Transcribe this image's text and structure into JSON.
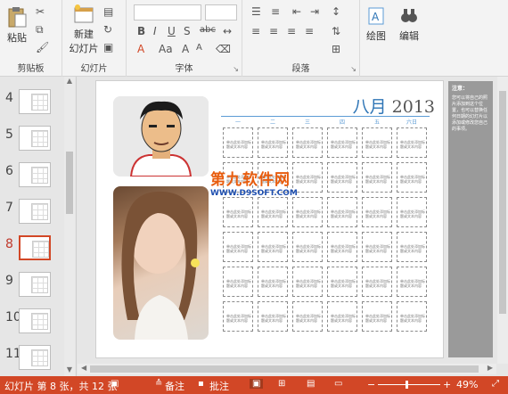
{
  "ribbon": {
    "clipboard": {
      "paste_label": "粘贴",
      "group_label": "剪贴板"
    },
    "slides": {
      "new_slide_line1": "新建",
      "new_slide_line2": "幻灯片",
      "group_label": "幻灯片"
    },
    "font": {
      "group_label": "字体"
    },
    "paragraph": {
      "group_label": "段落"
    },
    "drawing": {
      "label": "绘图"
    },
    "editing": {
      "label": "编辑"
    }
  },
  "thumbnails": [
    {
      "num": "4",
      "selected": false
    },
    {
      "num": "5",
      "selected": false
    },
    {
      "num": "6",
      "selected": false
    },
    {
      "num": "7",
      "selected": false
    },
    {
      "num": "8",
      "selected": true
    },
    {
      "num": "9",
      "selected": false
    },
    {
      "num": "10",
      "selected": false
    },
    {
      "num": "11",
      "selected": false
    }
  ],
  "slide": {
    "month": "八月",
    "year": "2013",
    "weekdays": [
      "一",
      "二",
      "三",
      "四",
      "五",
      "六日"
    ],
    "cell_text": "单击此处添加标题或文本内容",
    "watermark": {
      "cn": "第九软件网",
      "en": "WWW.D9SOFT.COM"
    }
  },
  "notes_panel": {
    "title": "注意：",
    "text": "您可以将自己的照片添加到这个位置，也可以替换任何日期的幻灯片以添加或修改您自己的事项。"
  },
  "status_bar": {
    "slide_info": "幻灯片 第 8 张，共 12 张",
    "notes_label": "备注",
    "comments_label": "批注",
    "zoom": "49%"
  },
  "colors": {
    "accent": "#d24726",
    "calendar_blue": "#2e75b6",
    "watermark_orange": "#e85c0d"
  }
}
